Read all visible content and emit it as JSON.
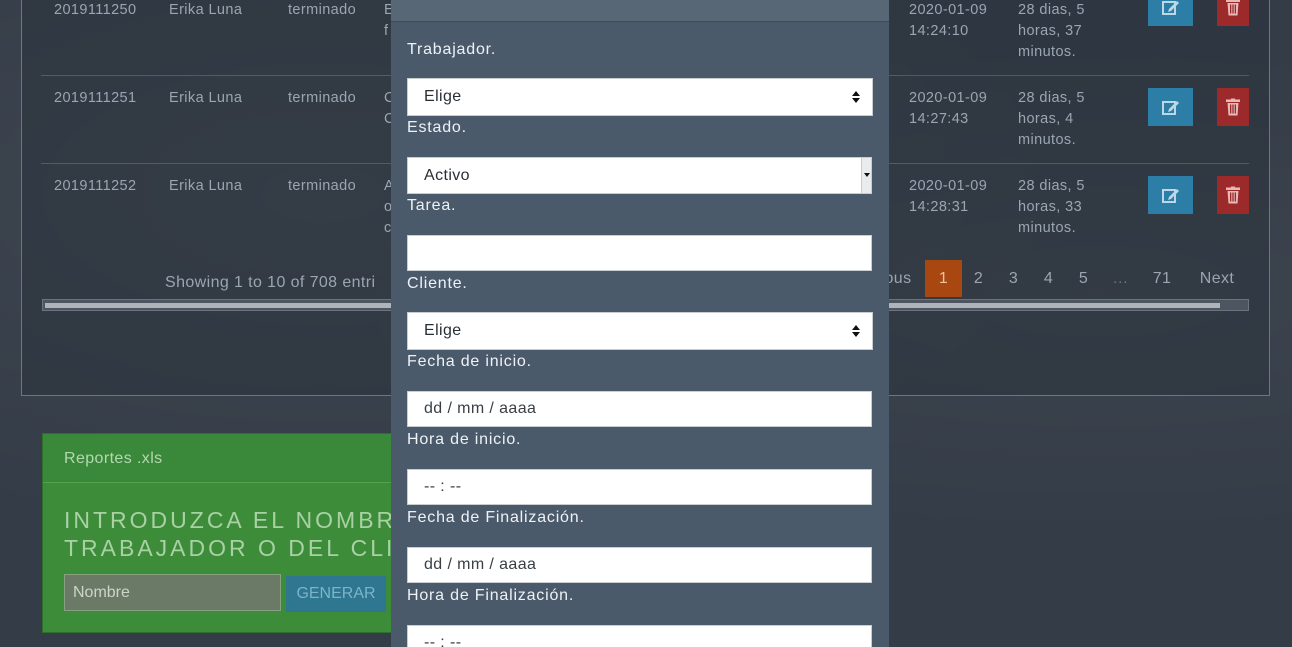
{
  "table": {
    "rows": [
      {
        "id": "2019111250",
        "name": "Erika Luna",
        "status": "terminado",
        "desc1": "E",
        "desc2": "f",
        "date": "2020-01-09",
        "time": "14:24:10",
        "dur1": "28 dias, 5",
        "dur2": "horas, 37",
        "dur3": "minutos."
      },
      {
        "id": "2019111251",
        "name": "Erika Luna",
        "status": "terminado",
        "desc1": "C",
        "desc2": "C",
        "date": "2020-01-09",
        "time": "14:27:43",
        "dur1": "28 dias, 5",
        "dur2": "horas, 4",
        "dur3": "minutos."
      },
      {
        "id": "2019111252",
        "name": "Erika Luna",
        "status": "terminado",
        "desc1": "A",
        "desc2": "o",
        "desc3": "c",
        "date": "2020-01-09",
        "time": "14:28:31",
        "dur1": "28 dias, 5",
        "dur2": "horas, 33",
        "dur3": "minutos."
      }
    ],
    "showing_text": "Showing 1 to 10 of 708 entri",
    "pagination": {
      "prev": "ous",
      "pages": [
        "1",
        "2",
        "3",
        "4",
        "5",
        "…",
        "71"
      ],
      "next": "Next"
    }
  },
  "reports": {
    "title": "Reportes .xls",
    "instruction": "INTRODUZCA EL NOMBR\nTRABAJADOR O DEL CLI",
    "input_placeholder": "Nombre",
    "button_label": "GENERAR"
  },
  "modal": {
    "fields": [
      {
        "label": "Trabajador.",
        "value": "Elige"
      },
      {
        "label": "Estado.",
        "value": "Activo"
      },
      {
        "label": "Tarea.",
        "value": ""
      },
      {
        "label": "Cliente.",
        "value": "Elige"
      },
      {
        "label": "Fecha de inicio.",
        "value": "dd / mm / aaaa"
      },
      {
        "label": "Hora de inicio.",
        "value": "-- : --"
      },
      {
        "label": "Fecha de Finalización.",
        "value": "dd / mm / aaaa"
      },
      {
        "label": "Hora de Finalización.",
        "value": "-- : --"
      }
    ]
  },
  "colors": {
    "edit": "#2c7ea6",
    "delete": "#9c2a2a",
    "active_page": "#a8470f",
    "reports_bg": "#3c8c3a",
    "modal_bg": "#4b5a6a"
  },
  "icons": {
    "edit": "pencil-square-icon",
    "delete": "trash-icon",
    "select": "select-arrows-icon"
  }
}
